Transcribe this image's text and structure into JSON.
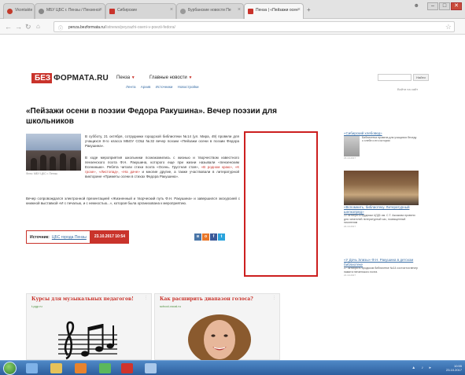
{
  "browser": {
    "tabs": [
      {
        "label": "Vkontakte",
        "active": false,
        "favicon_color": "#c23a2b"
      },
      {
        "label": "МБУ ЦБС г. Пензы / Пензенск",
        "active": false,
        "favicon_color": "#888888"
      },
      {
        "label": "Сибирские",
        "active": false,
        "favicon_color": "#c9332b"
      },
      {
        "label": "Бурбанские новости Пе",
        "active": false,
        "favicon_color": "#999999"
      },
      {
        "label": "Пенза | «Пейзажи осен",
        "active": true,
        "favicon_color": "#c9332b"
      }
    ],
    "new_tab": "+",
    "window_buttons": [
      "–",
      "□",
      "✕"
    ],
    "address": {
      "host": "penza.bezformata.ru",
      "path": "/listnews/peyzazhi-oseni-v-poezii-fedora/"
    }
  },
  "site": {
    "logo_a": "БЕЗ",
    "logo_b": "ФОРМАТА.RU",
    "city": "Пенза",
    "news_menu": "Главные новости",
    "subnav": [
      "Лента",
      "Архив",
      "Источники",
      "Новостройки"
    ],
    "search_button": "Найти",
    "header_right": "Войти на сайт"
  },
  "article": {
    "title": "«Пейзажи осени в поэзии Федора Ракушина». Вечер поэзии для школьников",
    "photo_caption": "Фото: МБУ ЦБС г. Пензы",
    "lead": "В субботу, 21 октября, сотрудники городской библиотеки №14 (ул. Мира, 49) провели для учащихся 8-го класса МБОУ СОШ №32 вечер поэзии «Пейзажи осени в поэзии Федора Ракушина».",
    "para_a": "В ходе мероприятия школьники познакомились с жизнью и творчеством известного пензенского поэта Ф.Н. Ракушина, которого еще при жизни называли «пензенским Есениным». Ребята читали стихи поэта «Осень. Грустная стая», ",
    "para_hl": "«В родном краю», «К грозе», «Листопад», «На даче»",
    "para_b": " и многие другие, а также участвовали в литературной викторине «Приметы осени в стихах Федора Ракушина».",
    "para2": "Вечер сопровождался электронной презентацией «Жизненный и творческий путь Ф.Н. Ракушина» и завершился экскурсией с книжной выставкой «И с печалью, и с нежностью...», которая была организована к мероприятию.",
    "source_label": "Источник:",
    "source_name": "ЦБС города Пензы",
    "date": "23.10.2017  10:54"
  },
  "sidebar": [
    {
      "headline": "«Сибирский хлебовед»",
      "text": "Библиотека провела для учащихся беседу о хлебе и его истории",
      "date": "23.10.2017"
    },
    {
      "headline": "«Вспомнить, библиотеку. Литературный шелкопряд»",
      "text": "22 октября сотрудники ЦГДБ им. С.Т. Аксакова провели для читателей литературный час, посвященный писателям",
      "date": "22.10.2017"
    },
    {
      "headline": "«У Дочь Элизы» Ф.Н. Ракушина в детском библиотеке",
      "text": "27 октября в городском библиотеке №14 состоится вечер памяти пензенского поэта",
      "date": "21.10.2017"
    }
  ],
  "ads": [
    {
      "title": "Курсы для музыкальных педагогов!",
      "domain": "t-pgp.ru"
    },
    {
      "title": "Как расширить диапазон голоса?",
      "domain": "school-vocal.ru"
    }
  ],
  "colors": {
    "brand_red": "#c9332b",
    "link_blue": "#3a6ea5",
    "ad_border": "#cc1f1f",
    "taskbar": "#2d5f9e"
  },
  "icons": [
    "back-arrow-icon",
    "forward-arrow-icon",
    "reload-icon",
    "home-icon",
    "lock-icon",
    "star-icon",
    "user-icon",
    "share-icon",
    "windows-start-icon"
  ],
  "taskbar": {
    "time": "10:55",
    "date": "23.10.2017"
  }
}
